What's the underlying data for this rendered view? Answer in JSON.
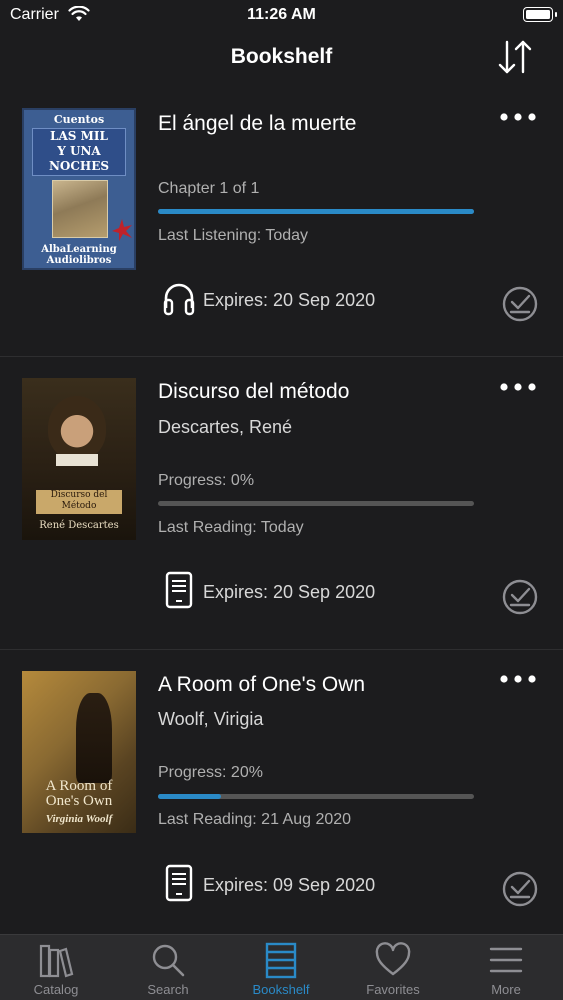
{
  "status_bar": {
    "carrier": "Carrier",
    "time": "11:26 AM"
  },
  "nav": {
    "title": "Bookshelf"
  },
  "books": [
    {
      "title": "El ángel de la muerte",
      "author": "",
      "progress_label": "Chapter 1 of 1",
      "progress": 1.0,
      "last_label": "Last Listening: Today",
      "expires_label": "Expires: 20 Sep 2020",
      "format_icon": "headphones-icon",
      "cover": {
        "top_text": "Cuentos",
        "title_lines": [
          "LAS MIL",
          "Y UNA",
          "NOCHES"
        ],
        "bottom_lines": [
          "AlbaLearning",
          "Audiolibros"
        ]
      }
    },
    {
      "title": "Discurso del método",
      "author": "Descartes, René",
      "progress_label": "Progress: 0%",
      "progress": 0.0,
      "last_label": "Last Reading: Today",
      "expires_label": "Expires: 20 Sep 2020",
      "format_icon": "ebook-icon",
      "cover": {
        "title_lines": [
          "Discurso del",
          "Método"
        ],
        "author": "René Descartes"
      }
    },
    {
      "title": "A Room of One's Own",
      "author": "Woolf, Virigia",
      "progress_label": "Progress: 20%",
      "progress": 0.2,
      "last_label": "Last Reading: 21 Aug 2020",
      "expires_label": "Expires: 09 Sep 2020",
      "format_icon": "ebook-icon",
      "cover": {
        "title_lines": [
          "A Room of",
          "One's Own"
        ],
        "author": "Virginia Woolf"
      }
    }
  ],
  "tabs": [
    {
      "label": "Catalog",
      "icon": "books-icon",
      "active": false
    },
    {
      "label": "Search",
      "icon": "search-icon",
      "active": false
    },
    {
      "label": "Bookshelf",
      "icon": "bookshelf-icon",
      "active": true
    },
    {
      "label": "Favorites",
      "icon": "heart-icon",
      "active": false
    },
    {
      "label": "More",
      "icon": "menu-icon",
      "active": false
    }
  ],
  "colors": {
    "accent": "#2a8ac7",
    "background": "#1c1c1e",
    "tab_bar": "#2c2c2e"
  }
}
